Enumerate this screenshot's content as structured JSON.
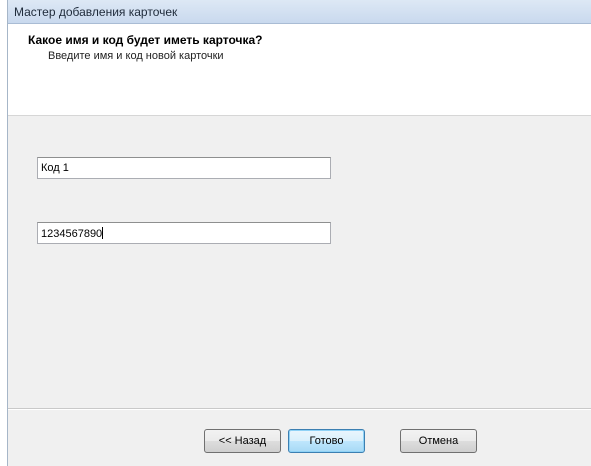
{
  "window": {
    "title": "Мастер добавления карточек"
  },
  "header": {
    "heading": "Какое имя и код будет иметь карточка?",
    "subheading": "Введите имя и код новой карточки"
  },
  "form": {
    "name_value": "Код 1",
    "code_value": "1234567890"
  },
  "buttons": {
    "back_label": "<< Назад",
    "done_label": "Готово",
    "cancel_label": "Отмена"
  }
}
